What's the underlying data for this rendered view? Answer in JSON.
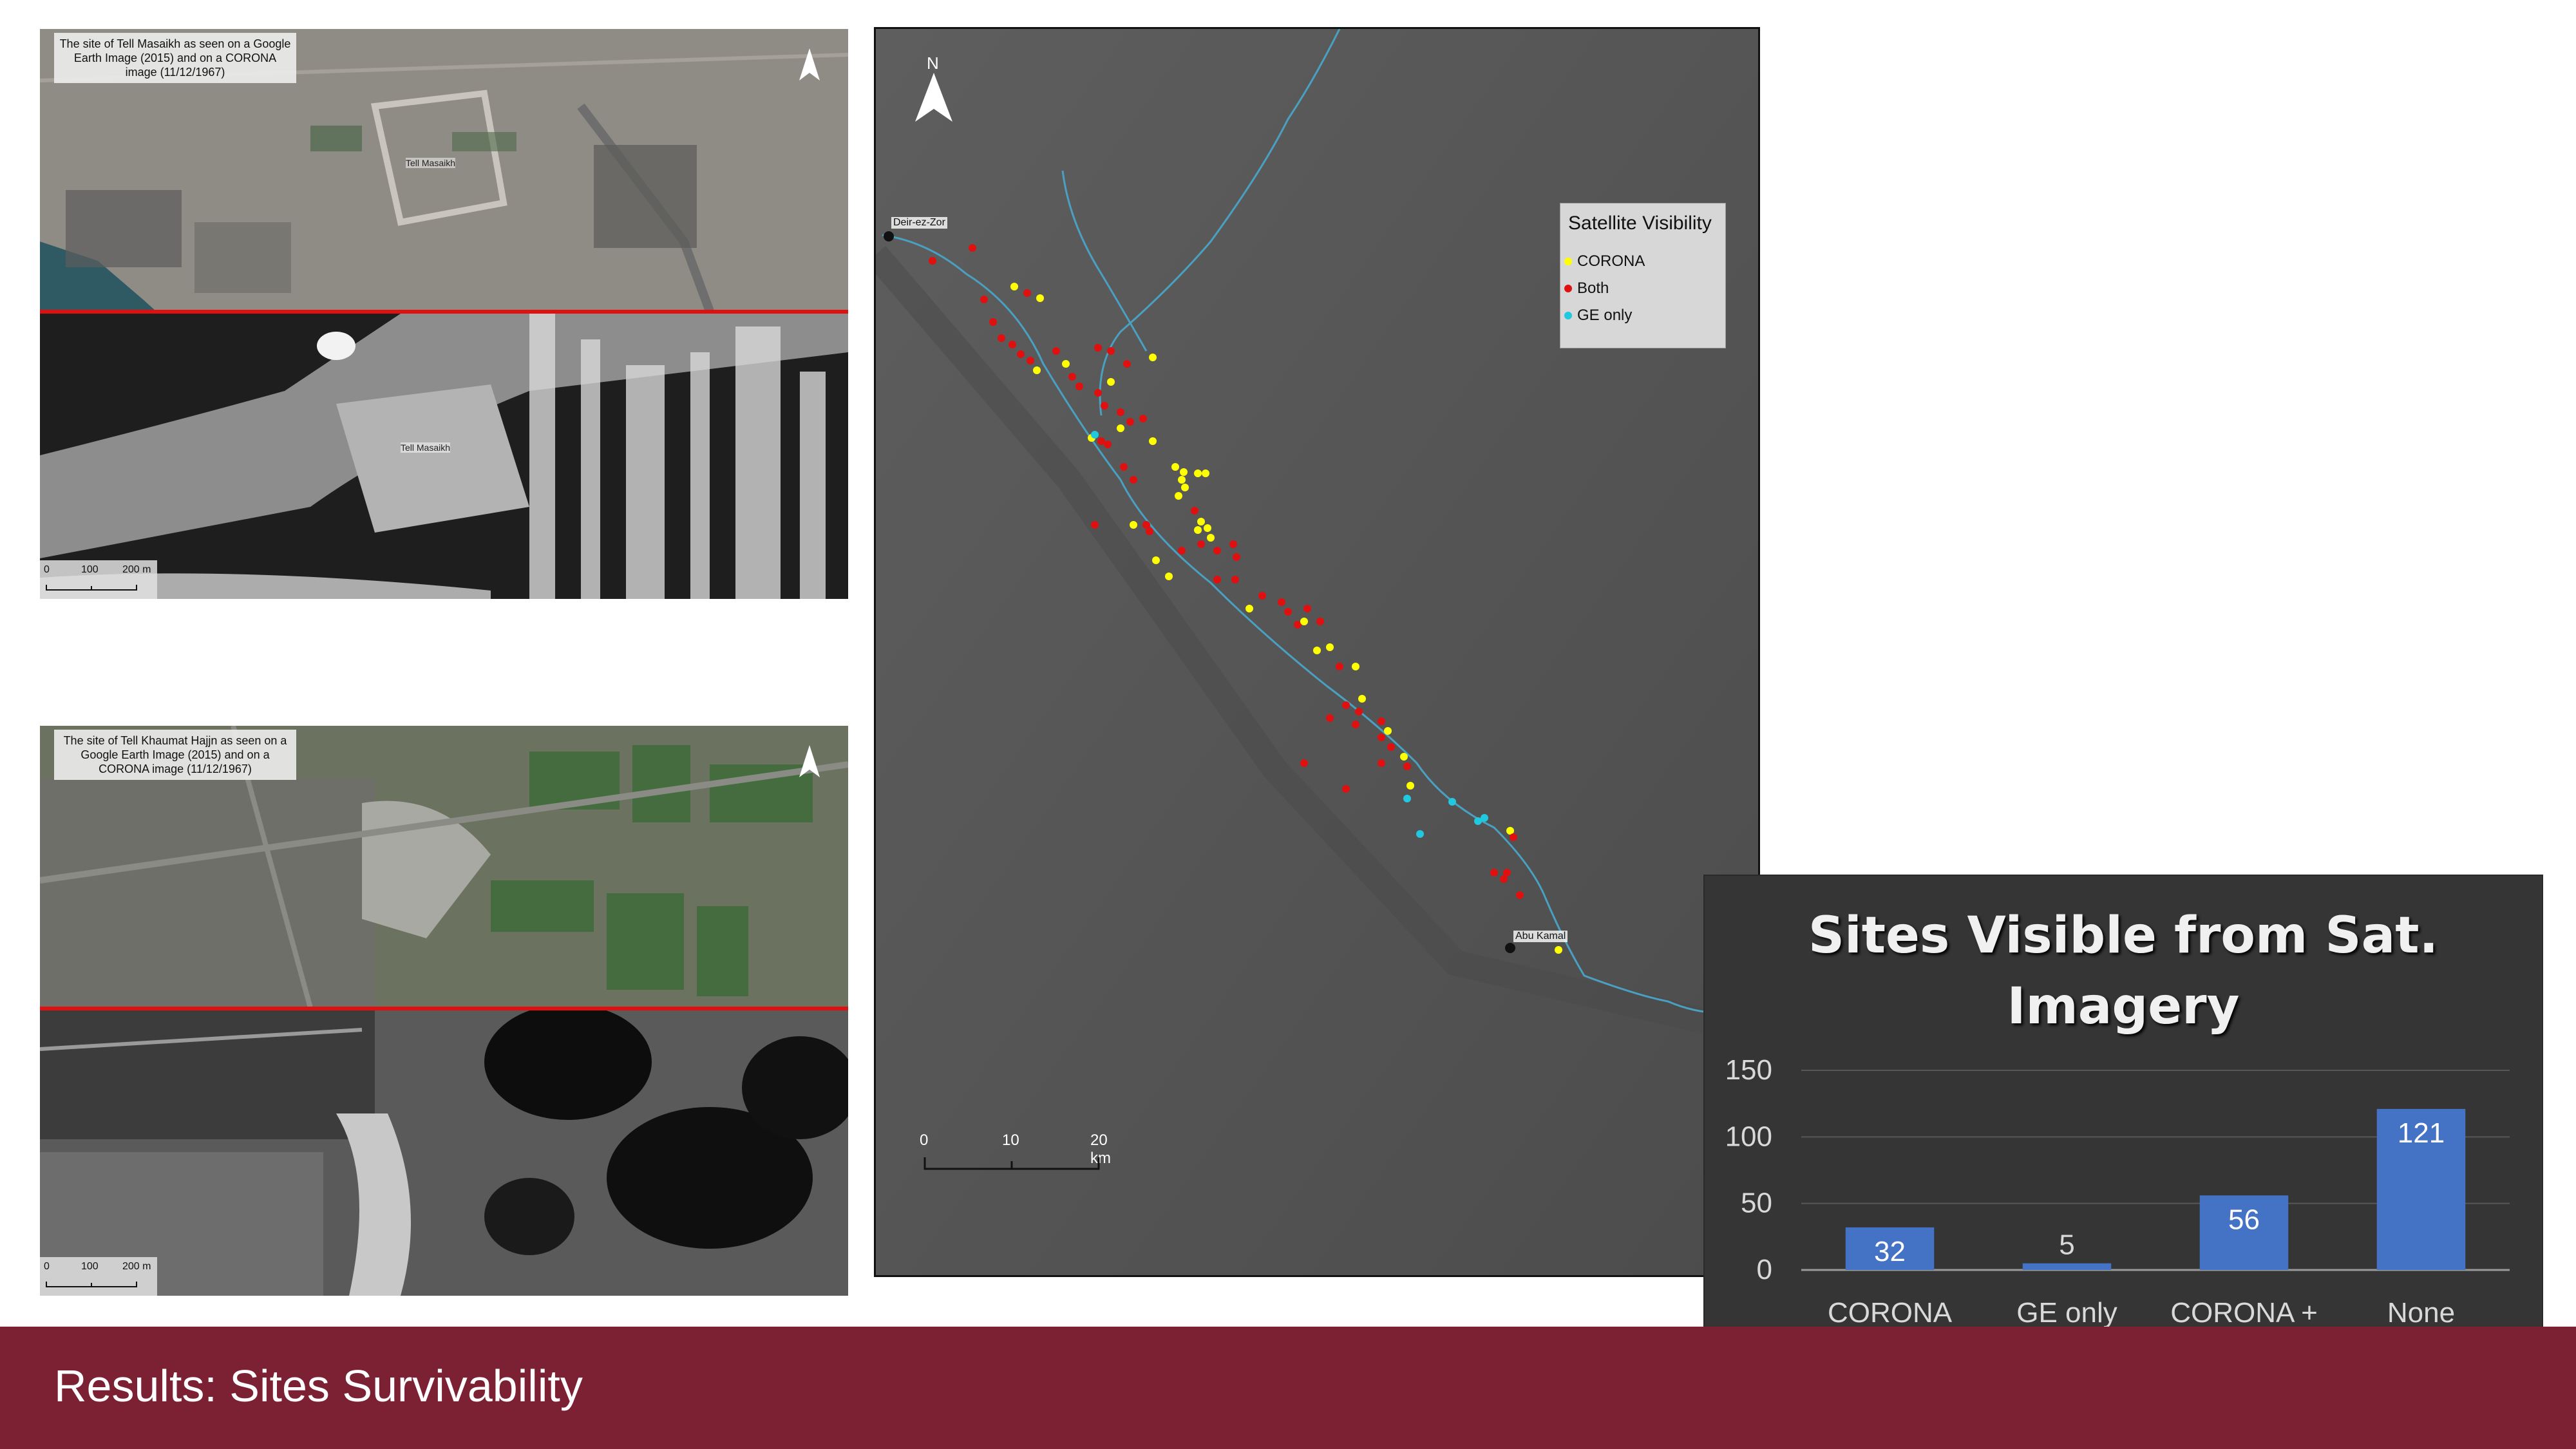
{
  "top_left_panel": {
    "caption": "The site of Tell Masaikh as seen on a Google Earth Image (2015) and on a CORONA image (11/12/1967)",
    "site_label_upper": "Tell Masaikh",
    "site_label_lower": "Tell Masaikh",
    "scale": [
      "0",
      "100",
      "200 m"
    ]
  },
  "bottom_left_panel": {
    "caption": "The site of Tell Khaumat Hajjn as seen on a Google Earth Image (2015) and on a CORONA image (11/12/1967)",
    "scale": [
      "0",
      "100",
      "200 m"
    ]
  },
  "map": {
    "north_label": "N",
    "legend": {
      "title": "Satellite Visibility",
      "items": [
        {
          "label": "CORONA",
          "color": "#ffff00"
        },
        {
          "label": "Both",
          "color": "#e01010"
        },
        {
          "label": "GE only",
          "color": "#20c8e0"
        }
      ]
    },
    "places": [
      "Deir-ez-Zor",
      "Abu Kamal"
    ],
    "scale": [
      "0",
      "10",
      "20 km"
    ]
  },
  "chart_data": {
    "type": "bar",
    "title": "Sites Visible from Sat. Imagery",
    "categories": [
      "CORONA only",
      "GE only",
      "CORONA + GE",
      "None"
    ],
    "values": [
      32,
      5,
      56,
      121
    ],
    "ylim": [
      0,
      150
    ],
    "yticks": [
      0,
      50,
      100,
      150
    ],
    "bar_color": "#4472c4",
    "grid": true,
    "data_labels": [
      "32",
      "5",
      "56",
      "121"
    ]
  },
  "footer": {
    "title": "Results: Sites Survivability"
  }
}
